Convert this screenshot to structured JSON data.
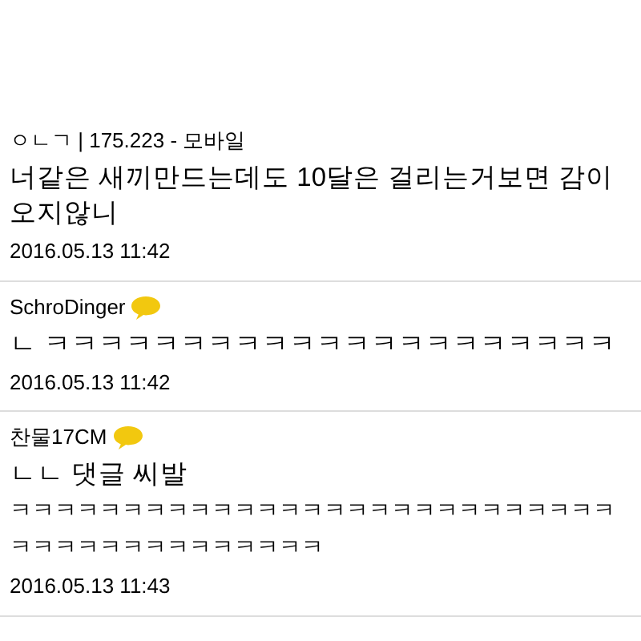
{
  "comments": [
    {
      "author": "ㅇㄴㄱ | 175.223 - 모바일",
      "kakao": false,
      "body": "너같은 새끼만드는데도 10달은 걸리는거보면 감이 오지않니",
      "date": "2016.05.13 11:42"
    },
    {
      "author": "SchroDinger",
      "kakao": true,
      "body": "ㄴ ㅋㅋㅋㅋㅋㅋㅋㅋㅋㅋㅋㅋㅋㅋㅋㅋㅋㅋㅋㅋㅋ",
      "date": "2016.05.13 11:42"
    },
    {
      "author": "찬물17CM",
      "kakao": true,
      "body": "ㄴㄴ 댓글 씨발",
      "extra": "ㅋㅋㅋㅋㅋㅋㅋㅋㅋㅋㅋㅋㅋㅋㅋㅋㅋㅋㅋㅋㅋㅋㅋㅋㅋㅋㅋㅋㅋㅋㅋㅋㅋㅋㅋㅋㅋㅋㅋㅋㅋ",
      "date": "2016.05.13 11:43"
    }
  ]
}
